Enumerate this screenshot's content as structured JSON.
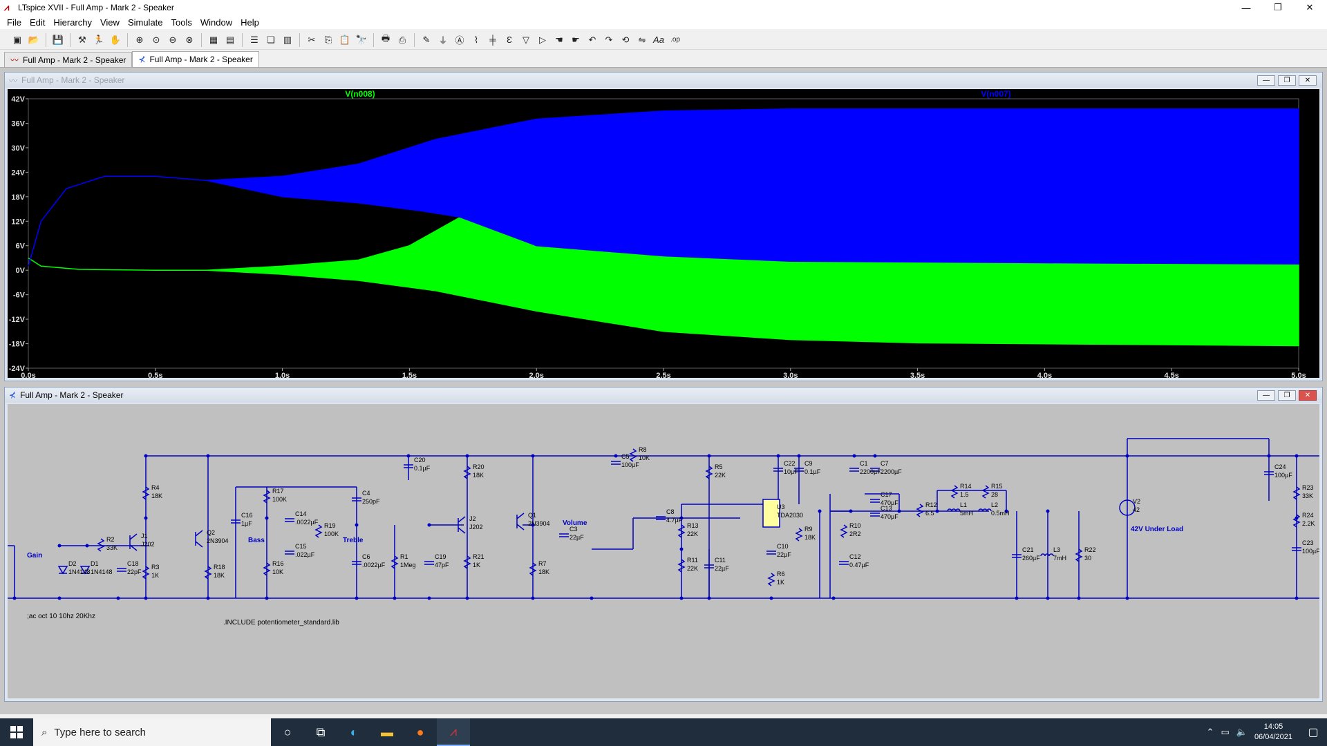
{
  "app": {
    "title": "LTspice XVII - Full Amp - Mark 2 - Speaker"
  },
  "menu": [
    "File",
    "Edit",
    "Hierarchy",
    "View",
    "Simulate",
    "Tools",
    "Window",
    "Help"
  ],
  "tabs": [
    {
      "label": "Full Amp - Mark 2 - Speaker",
      "kind": "waveform"
    },
    {
      "label": "Full Amp - Mark 2 - Speaker",
      "kind": "schematic"
    }
  ],
  "plot_window": {
    "title": "Full Amp - Mark 2 - Speaker"
  },
  "schematic_window": {
    "title": "Full Amp - Mark 2 - Speaker"
  },
  "chart_data": {
    "type": "line",
    "series": [
      {
        "name": "V(n008)",
        "color": "#00ff00"
      },
      {
        "name": "V(n007)",
        "color": "#0000ff"
      }
    ],
    "x_ticks": [
      "0.0s",
      "0.5s",
      "1.0s",
      "1.5s",
      "2.0s",
      "2.5s",
      "3.0s",
      "3.5s",
      "4.0s",
      "4.5s",
      "5.0s"
    ],
    "y_ticks": [
      "42V",
      "36V",
      "30V",
      "24V",
      "18V",
      "12V",
      "6V",
      "0V",
      "-6V",
      "-12V",
      "-18V",
      "-24V"
    ],
    "xlim": [
      0,
      5
    ],
    "ylim": [
      -24,
      42
    ],
    "blue_upper_envelope": [
      [
        0.0,
        1
      ],
      [
        0.05,
        12
      ],
      [
        0.15,
        20
      ],
      [
        0.3,
        23
      ],
      [
        0.5,
        23
      ],
      [
        0.7,
        22
      ],
      [
        1.0,
        23
      ],
      [
        1.3,
        26
      ],
      [
        1.6,
        32
      ],
      [
        2.0,
        37
      ],
      [
        2.5,
        39
      ],
      [
        3.0,
        39.5
      ],
      [
        5.0,
        39.5
      ]
    ],
    "blue_lower_envelope": [
      [
        0.0,
        1
      ],
      [
        0.05,
        12
      ],
      [
        0.15,
        20
      ],
      [
        0.3,
        23
      ],
      [
        0.5,
        23
      ],
      [
        0.7,
        22
      ],
      [
        1.0,
        18
      ],
      [
        1.3,
        16.5
      ],
      [
        1.55,
        14.5
      ],
      [
        1.7,
        13
      ],
      [
        2.0,
        6
      ],
      [
        2.5,
        3.5
      ],
      [
        3.0,
        2.2
      ],
      [
        4.0,
        1.8
      ],
      [
        5.0,
        1.5
      ]
    ],
    "green_upper_envelope": [
      [
        0.0,
        3
      ],
      [
        0.05,
        1
      ],
      [
        0.2,
        0.2
      ],
      [
        0.5,
        0
      ],
      [
        0.7,
        0
      ],
      [
        1.0,
        1
      ],
      [
        1.3,
        2.5
      ],
      [
        1.5,
        6
      ],
      [
        1.7,
        13
      ],
      [
        2.0,
        6
      ],
      [
        2.5,
        3.5
      ],
      [
        3.0,
        2.2
      ],
      [
        4.0,
        1.8
      ],
      [
        5.0,
        1.5
      ]
    ],
    "green_lower_envelope": [
      [
        0.0,
        3
      ],
      [
        0.05,
        1
      ],
      [
        0.2,
        0.2
      ],
      [
        0.5,
        0
      ],
      [
        0.7,
        0
      ],
      [
        1.0,
        -1
      ],
      [
        1.3,
        -2.5
      ],
      [
        1.6,
        -5
      ],
      [
        2.0,
        -10
      ],
      [
        2.5,
        -15
      ],
      [
        3.0,
        -17
      ],
      [
        3.5,
        -17.8
      ],
      [
        5.0,
        -18.5
      ]
    ]
  },
  "schematic": {
    "directives": [
      ";ac oct 10 10hz 20Khz",
      ".INCLUDE potentiometer_standard.lib"
    ],
    "labels": [
      "Gain",
      "Bass",
      "Treble",
      "Volume",
      "42V Under Load"
    ],
    "components": [
      {
        "ref": "R2",
        "value": "33K"
      },
      {
        "ref": "D2",
        "value": "1N4148"
      },
      {
        "ref": "D1",
        "value": "1N4148"
      },
      {
        "ref": "C18",
        "value": "22pF"
      },
      {
        "ref": "J1",
        "value": "J202"
      },
      {
        "ref": "R4",
        "value": "18K"
      },
      {
        "ref": "R3",
        "value": "1K"
      },
      {
        "ref": "Q2",
        "value": "2N3904"
      },
      {
        "ref": "R18",
        "value": "18K"
      },
      {
        "ref": "C16",
        "value": "1µF"
      },
      {
        "ref": "R17",
        "value": "100K"
      },
      {
        "ref": "C14",
        "value": ".0022µF"
      },
      {
        "ref": "R19",
        "value": "100K"
      },
      {
        "ref": "C15",
        "value": ".022µF"
      },
      {
        "ref": "R16",
        "value": "10K"
      },
      {
        "ref": "C4",
        "value": "250pF"
      },
      {
        "ref": "C6",
        "value": ".0022µF"
      },
      {
        "ref": "R1",
        "value": "1Meg"
      },
      {
        "ref": "C20",
        "value": "0.1µF"
      },
      {
        "ref": "C19",
        "value": "47pF"
      },
      {
        "ref": "R20",
        "value": "18K"
      },
      {
        "ref": "J2",
        "value": "J202"
      },
      {
        "ref": "R21",
        "value": "1K"
      },
      {
        "ref": "Q1",
        "value": "2N3904"
      },
      {
        "ref": "R7",
        "value": "18K"
      },
      {
        "ref": "C3",
        "value": "22µF"
      },
      {
        "ref": "C5",
        "value": "100µF"
      },
      {
        "ref": "R8",
        "value": "10K"
      },
      {
        "ref": "C8",
        "value": "4.7µF"
      },
      {
        "ref": "R13",
        "value": "22K"
      },
      {
        "ref": "R11",
        "value": "22K"
      },
      {
        "ref": "R5",
        "value": "22K"
      },
      {
        "ref": "C11",
        "value": "22µF"
      },
      {
        "ref": "C22",
        "value": "10µF"
      },
      {
        "ref": "C9",
        "value": "0.1µF"
      },
      {
        "ref": "U3",
        "value": "TDA2030"
      },
      {
        "ref": "C10",
        "value": "22µF"
      },
      {
        "ref": "R6",
        "value": "1K"
      },
      {
        "ref": "R9",
        "value": "18K"
      },
      {
        "ref": "C1",
        "value": "2200µF"
      },
      {
        "ref": "C7",
        "value": "2200µF"
      },
      {
        "ref": "C17",
        "value": "470µF"
      },
      {
        "ref": "C13",
        "value": "470µF"
      },
      {
        "ref": "R10",
        "value": "2R2"
      },
      {
        "ref": "C12",
        "value": "0.47µF"
      },
      {
        "ref": "R12",
        "value": "6.5"
      },
      {
        "ref": "R14",
        "value": "1.5"
      },
      {
        "ref": "L1",
        "value": "5mH"
      },
      {
        "ref": "R15",
        "value": "28"
      },
      {
        "ref": "L2",
        "value": "0.5mH"
      },
      {
        "ref": "C21",
        "value": "260µF"
      },
      {
        "ref": "L3",
        "value": "7mH"
      },
      {
        "ref": "R22",
        "value": "30"
      },
      {
        "ref": "V2",
        "value": "42"
      },
      {
        "ref": "C24",
        "value": "100µF"
      },
      {
        "ref": "R23",
        "value": "33K"
      },
      {
        "ref": "R24",
        "value": "2.2K"
      },
      {
        "ref": "C23",
        "value": "100µF"
      }
    ]
  },
  "taskbar": {
    "search_placeholder": "Type here to search",
    "time": "14:05",
    "date": "06/04/2021"
  }
}
